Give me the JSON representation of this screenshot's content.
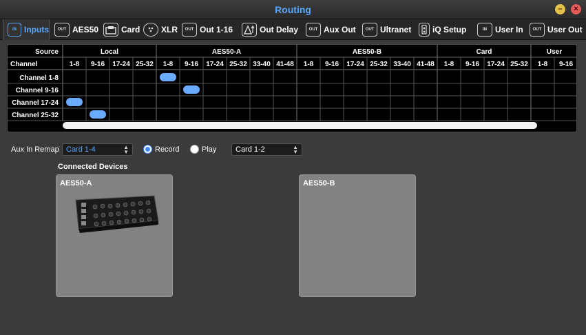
{
  "window": {
    "title": "Routing"
  },
  "tabs": [
    {
      "label": "Inputs",
      "icon": "in-icon",
      "icon_text": "IN",
      "active": true
    },
    {
      "label": "AES50",
      "icon": "out-icon",
      "icon_text": "OUT",
      "active": false
    },
    {
      "label": "Card",
      "icon": "card-icon",
      "icon_text": "",
      "active": false
    },
    {
      "label": "XLR",
      "icon": "xlr-icon",
      "icon_text": "",
      "active": false
    },
    {
      "label": "Out 1-16",
      "icon": "out-icon",
      "icon_text": "OUT",
      "active": false
    },
    {
      "label": "Out Delay",
      "icon": "delay-icon",
      "icon_text": "",
      "active": false
    },
    {
      "label": "Aux Out",
      "icon": "out-icon",
      "icon_text": "OUT",
      "active": false
    },
    {
      "label": "Ultranet",
      "icon": "out-icon",
      "icon_text": "OUT",
      "active": false
    },
    {
      "label": "iQ Setup",
      "icon": "iq-icon",
      "icon_text": "",
      "active": false
    },
    {
      "label": "User In",
      "icon": "in-icon",
      "icon_text": "IN",
      "active": false
    },
    {
      "label": "User Out",
      "icon": "out-icon",
      "icon_text": "OUT",
      "active": false
    }
  ],
  "matrix": {
    "source_label": "Source",
    "channel_label": "Channel",
    "groups": [
      {
        "name": "Local",
        "cols": [
          "1-8",
          "9-16",
          "17-24",
          "25-32"
        ]
      },
      {
        "name": "AES50-A",
        "cols": [
          "1-8",
          "9-16",
          "17-24",
          "25-32",
          "33-40",
          "41-48"
        ]
      },
      {
        "name": "AES50-B",
        "cols": [
          "1-8",
          "9-16",
          "17-24",
          "25-32",
          "33-40",
          "41-48"
        ]
      },
      {
        "name": "Card",
        "cols": [
          "1-8",
          "9-16",
          "17-24",
          "25-32"
        ]
      },
      {
        "name": "User",
        "cols": [
          "1-8",
          "9-16"
        ]
      }
    ],
    "rows": [
      "Channel 1-8",
      "Channel 9-16",
      "Channel 17-24",
      "Channel 25-32"
    ],
    "routes": [
      {
        "row": 0,
        "col": 4
      },
      {
        "row": 1,
        "col": 5
      },
      {
        "row": 2,
        "col": 0
      },
      {
        "row": 3,
        "col": 1
      }
    ],
    "accent": "#6aaaff"
  },
  "aux_remap": {
    "label": "Aux In Remap",
    "selected": "Card 1-4",
    "record_label": "Record",
    "play_label": "Play",
    "mode": "Record",
    "play_selected": "Card 1-2"
  },
  "connected_devices": {
    "title": "Connected Devices",
    "cards": [
      {
        "name": "AES50-A",
        "has_device": true
      },
      {
        "name": "AES50-B",
        "has_device": false
      }
    ]
  }
}
